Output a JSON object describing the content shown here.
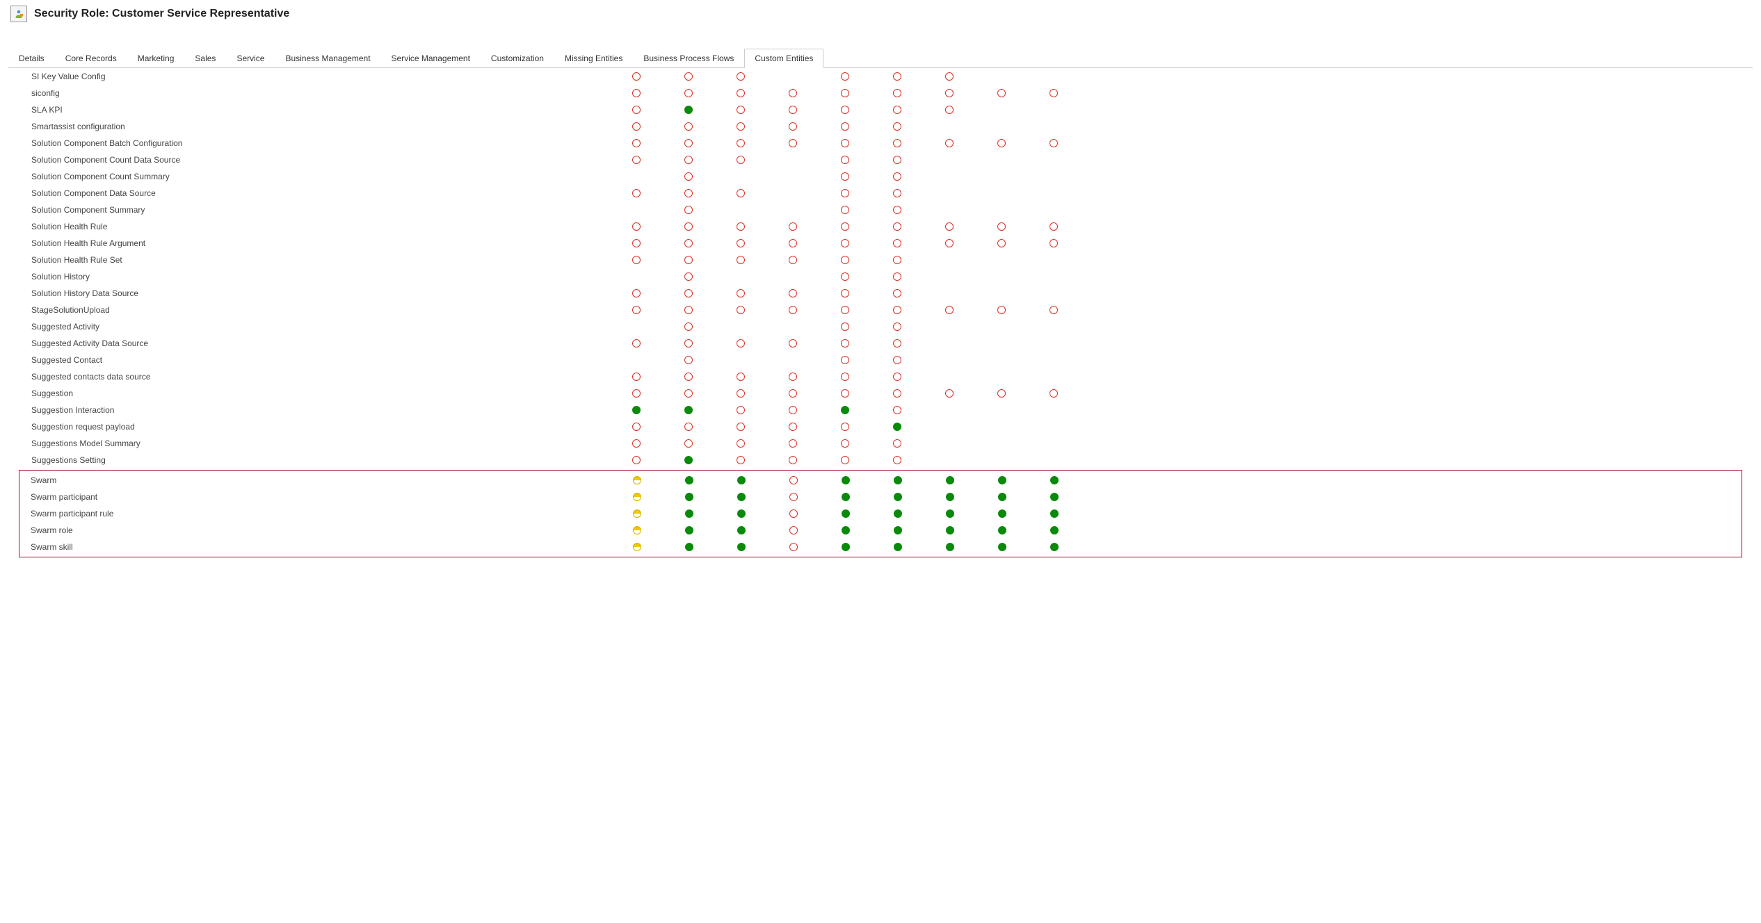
{
  "header": {
    "title": "Security Role: Customer Service Representative"
  },
  "tabs": [
    {
      "label": "Details",
      "active": false
    },
    {
      "label": "Core Records",
      "active": false
    },
    {
      "label": "Marketing",
      "active": false
    },
    {
      "label": "Sales",
      "active": false
    },
    {
      "label": "Service",
      "active": false
    },
    {
      "label": "Business Management",
      "active": false
    },
    {
      "label": "Service Management",
      "active": false
    },
    {
      "label": "Customization",
      "active": false
    },
    {
      "label": "Missing Entities",
      "active": false
    },
    {
      "label": "Business Process Flows",
      "active": false
    },
    {
      "label": "Custom Entities",
      "active": true
    }
  ],
  "perm_legend": {
    "none": "No permission (empty red circle)",
    "user": "User-level (yellow half-filled)",
    "org": "Organization-level (green filled)",
    "blank": "Not applicable"
  },
  "rows": [
    {
      "label": "SI Key Value Config",
      "perms": [
        "none",
        "none",
        "none",
        "blank",
        "none",
        "none",
        "none",
        "blank",
        "blank"
      ],
      "cutoff": true
    },
    {
      "label": "siconfig",
      "perms": [
        "none",
        "none",
        "none",
        "none",
        "none",
        "none",
        "none",
        "none",
        "none"
      ]
    },
    {
      "label": "SLA KPI",
      "perms": [
        "none",
        "org",
        "none",
        "none",
        "none",
        "none",
        "none",
        "blank",
        "blank"
      ]
    },
    {
      "label": "Smartassist configuration",
      "perms": [
        "none",
        "none",
        "none",
        "none",
        "none",
        "none",
        "blank",
        "blank",
        "blank"
      ]
    },
    {
      "label": "Solution Component Batch Configuration",
      "perms": [
        "none",
        "none",
        "none",
        "none",
        "none",
        "none",
        "none",
        "none",
        "none"
      ]
    },
    {
      "label": "Solution Component Count Data Source",
      "perms": [
        "none",
        "none",
        "none",
        "blank",
        "none",
        "none",
        "blank",
        "blank",
        "blank"
      ]
    },
    {
      "label": "Solution Component Count Summary",
      "perms": [
        "blank",
        "none",
        "blank",
        "blank",
        "none",
        "none",
        "blank",
        "blank",
        "blank"
      ]
    },
    {
      "label": "Solution Component Data Source",
      "perms": [
        "none",
        "none",
        "none",
        "blank",
        "none",
        "none",
        "blank",
        "blank",
        "blank"
      ]
    },
    {
      "label": "Solution Component Summary",
      "perms": [
        "blank",
        "none",
        "blank",
        "blank",
        "none",
        "none",
        "blank",
        "blank",
        "blank"
      ]
    },
    {
      "label": "Solution Health Rule",
      "perms": [
        "none",
        "none",
        "none",
        "none",
        "none",
        "none",
        "none",
        "none",
        "none"
      ]
    },
    {
      "label": "Solution Health Rule Argument",
      "perms": [
        "none",
        "none",
        "none",
        "none",
        "none",
        "none",
        "none",
        "none",
        "none"
      ]
    },
    {
      "label": "Solution Health Rule Set",
      "perms": [
        "none",
        "none",
        "none",
        "none",
        "none",
        "none",
        "blank",
        "blank",
        "blank"
      ]
    },
    {
      "label": "Solution History",
      "perms": [
        "blank",
        "none",
        "blank",
        "blank",
        "none",
        "none",
        "blank",
        "blank",
        "blank"
      ]
    },
    {
      "label": "Solution History Data Source",
      "perms": [
        "none",
        "none",
        "none",
        "none",
        "none",
        "none",
        "blank",
        "blank",
        "blank"
      ]
    },
    {
      "label": "StageSolutionUpload",
      "perms": [
        "none",
        "none",
        "none",
        "none",
        "none",
        "none",
        "none",
        "none",
        "none"
      ]
    },
    {
      "label": "Suggested Activity",
      "perms": [
        "blank",
        "none",
        "blank",
        "blank",
        "none",
        "none",
        "blank",
        "blank",
        "blank"
      ]
    },
    {
      "label": "Suggested Activity Data Source",
      "perms": [
        "none",
        "none",
        "none",
        "none",
        "none",
        "none",
        "blank",
        "blank",
        "blank"
      ]
    },
    {
      "label": "Suggested Contact",
      "perms": [
        "blank",
        "none",
        "blank",
        "blank",
        "none",
        "none",
        "blank",
        "blank",
        "blank"
      ]
    },
    {
      "label": "Suggested contacts data source",
      "perms": [
        "none",
        "none",
        "none",
        "none",
        "none",
        "none",
        "blank",
        "blank",
        "blank"
      ]
    },
    {
      "label": "Suggestion",
      "perms": [
        "none",
        "none",
        "none",
        "none",
        "none",
        "none",
        "none",
        "none",
        "none"
      ]
    },
    {
      "label": "Suggestion Interaction",
      "perms": [
        "org",
        "org",
        "none",
        "none",
        "org",
        "none",
        "blank",
        "blank",
        "blank"
      ]
    },
    {
      "label": "Suggestion request payload",
      "perms": [
        "none",
        "none",
        "none",
        "none",
        "none",
        "org",
        "blank",
        "blank",
        "blank"
      ]
    },
    {
      "label": "Suggestions Model Summary",
      "perms": [
        "none",
        "none",
        "none",
        "none",
        "none",
        "none",
        "blank",
        "blank",
        "blank"
      ]
    },
    {
      "label": "Suggestions Setting",
      "perms": [
        "none",
        "org",
        "none",
        "none",
        "none",
        "none",
        "blank",
        "blank",
        "blank"
      ]
    }
  ],
  "highlighted_rows": [
    {
      "label": "Swarm",
      "perms": [
        "user",
        "org",
        "org",
        "none",
        "org",
        "org",
        "org",
        "org",
        "org"
      ]
    },
    {
      "label": "Swarm participant",
      "perms": [
        "user",
        "org",
        "org",
        "none",
        "org",
        "org",
        "org",
        "org",
        "org"
      ]
    },
    {
      "label": "Swarm participant rule",
      "perms": [
        "user",
        "org",
        "org",
        "none",
        "org",
        "org",
        "org",
        "org",
        "org"
      ]
    },
    {
      "label": "Swarm role",
      "perms": [
        "user",
        "org",
        "org",
        "none",
        "org",
        "org",
        "org",
        "org",
        "org"
      ]
    },
    {
      "label": "Swarm skill",
      "perms": [
        "user",
        "org",
        "org",
        "none",
        "org",
        "org",
        "org",
        "org",
        "org"
      ]
    }
  ]
}
